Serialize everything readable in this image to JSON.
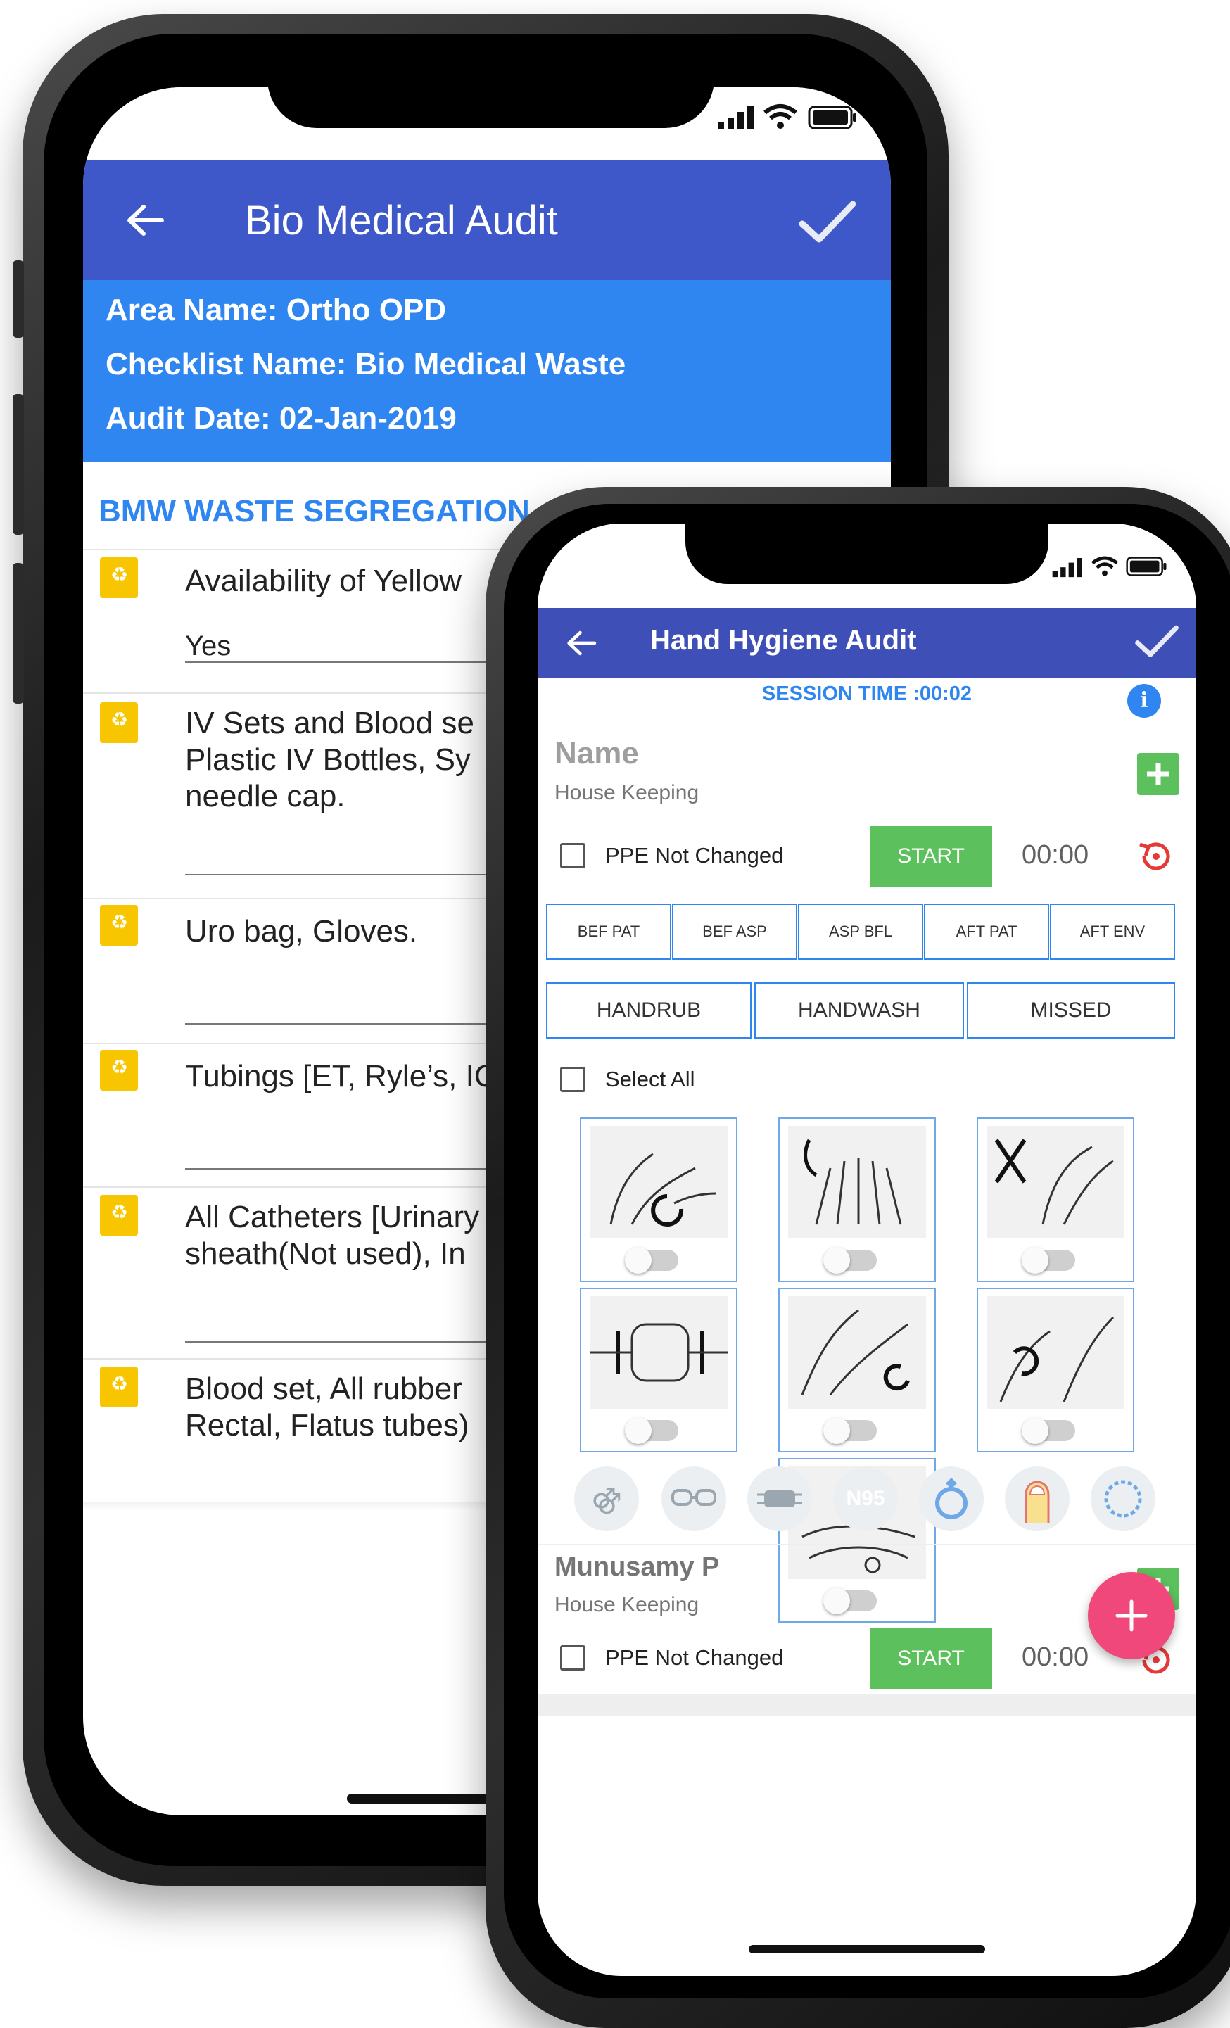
{
  "phone1": {
    "status": {
      "signal_icon": "signal-bars-icon",
      "wifi_icon": "wifi-icon",
      "battery_icon": "battery-icon"
    },
    "appbar": {
      "title": "Bio Medical Audit",
      "back_icon": "arrow-left-icon",
      "check_icon": "check-icon"
    },
    "info": {
      "area": "Area Name: Ortho OPD",
      "checklist": "Checklist Name: Bio Medical Waste",
      "date": "Audit Date: 02-Jan-2019"
    },
    "section_title": "BMW WASTE SEGREGATION",
    "items": [
      {
        "line1": "Availability of Yellow",
        "line2": "",
        "answer": "Yes",
        "icon": "yellow-bin-icon"
      },
      {
        "line1": "IV Sets and Blood se",
        "line2": "Plastic IV Bottles, Sy",
        "line3": "needle cap.",
        "answer": "",
        "icon": "yellow-bin-icon"
      },
      {
        "line1": "Uro bag, Gloves.",
        "answer": "",
        "icon": "yellow-bin-icon"
      },
      {
        "line1": "Tubings [ET, Ryle’s, IC",
        "answer": "",
        "icon": "yellow-bin-icon"
      },
      {
        "line1": "All Catheters [Urinary",
        "line2": "sheath(Not used), In",
        "answer": "",
        "icon": "yellow-bin-icon"
      },
      {
        "line1": "Blood set, All rubber",
        "line2": "Rectal, Flatus tubes)",
        "answer": "",
        "icon": "yellow-bin-icon"
      }
    ]
  },
  "phone2": {
    "status": {
      "signal_icon": "signal-bars-icon",
      "wifi_icon": "wifi-icon",
      "battery_icon": "battery-icon"
    },
    "appbar": {
      "title": "Hand Hygiene Audit",
      "back_icon": "arrow-left-icon",
      "check_icon": "check-icon"
    },
    "session_time": "SESSION TIME :00:02",
    "info_icon": "info-icon",
    "entry1": {
      "name": "Name",
      "role": "House Keeping",
      "ppe_label": "PPE Not Changed",
      "start_label": "START",
      "timer": "00:00",
      "add_icon": "plus-square-icon",
      "reset_icon": "reset-timer-icon"
    },
    "moments": [
      "BEF PAT",
      "BEF ASP",
      "ASP BFL",
      "AFT PAT",
      "AFT ENV"
    ],
    "actions": [
      "HANDRUB",
      "HANDWASH",
      "MISSED"
    ],
    "select_all": "Select All",
    "steps": [
      {
        "icon": "palm-to-palm-icon",
        "on": false
      },
      {
        "icon": "back-of-hands-icon",
        "on": false
      },
      {
        "icon": "interlaced-fingers-icon",
        "on": false
      },
      {
        "icon": "backs-of-fingers-icon",
        "on": false
      },
      {
        "icon": "rotational-thumb-icon",
        "on": false
      },
      {
        "icon": "fingertips-icon",
        "on": false
      },
      {
        "icon": "rinse-hands-icon",
        "on": false
      }
    ],
    "ppe_icons": [
      "apron-icon",
      "goggles-icon",
      "surgical-mask-icon",
      "n95-mask-icon",
      "ring-icon",
      "nail-icon",
      "bracelet-icon"
    ],
    "n95_label": "N95",
    "entry2": {
      "name": "Munusamy P",
      "role": "House Keeping",
      "ppe_label": "PPE Not Changed",
      "start_label": "START",
      "timer": "00:00"
    },
    "fab_icon": "plus-icon",
    "colors": {
      "appbar": "#3e4fb7",
      "info_band": "#2f86f0",
      "start_green": "#5cc15c",
      "fab": "#f0487a",
      "reset_red": "#e53935"
    }
  }
}
